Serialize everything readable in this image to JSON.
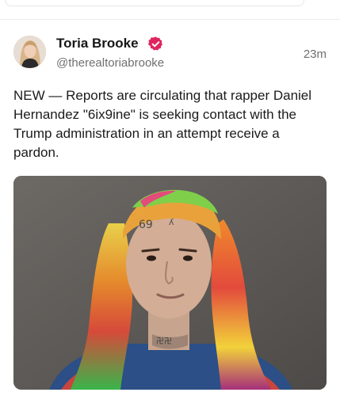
{
  "post": {
    "author": {
      "name": "Toria Brooke",
      "handle": "@therealtoriabrooke",
      "verified_icon": "verified-badge-icon",
      "verified_color": "#e0245e"
    },
    "timestamp": "23m",
    "text": "NEW — Reports are circulating that rapper Daniel Hernandez \"6ix9ine\" is seeking contact with the Trump administration in an attempt receive a pardon.",
    "media": {
      "kind": "photo",
      "subject": "portrait-photo"
    }
  },
  "colors": {
    "text_primary": "#1b1b1b",
    "text_secondary": "#6f6f6f",
    "accent_badge": "#e0245e",
    "divider": "#ececec"
  }
}
